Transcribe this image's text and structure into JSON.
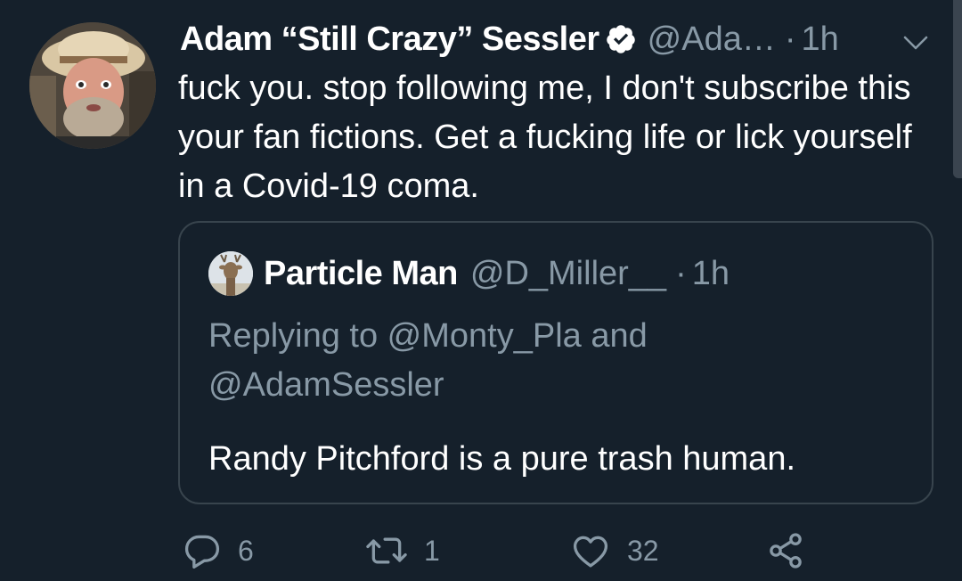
{
  "tweet": {
    "display_name": "Adam “Still Crazy” Sessler",
    "handle": "@Ada…",
    "separator": "·",
    "time": "1h",
    "text": "fuck you. stop following me, I don't subscribe this your fan fictions. Get a fucking life or lick yourself in a Covid-19 coma.",
    "icons": {
      "verified": "verified-badge-icon",
      "menu": "chevron-down-icon"
    }
  },
  "quote": {
    "display_name": "Particle Man",
    "handle": "@D_Miller__",
    "separator": "·",
    "time": "1h",
    "replying_to": "Replying to @Monty_Pla and @AdamSessler",
    "text": "Randy Pitchford is a pure trash human."
  },
  "actions": {
    "reply_count": "6",
    "retweet_count": "1",
    "like_count": "32",
    "icons": [
      "reply-icon",
      "retweet-icon",
      "like-icon",
      "share-icon"
    ]
  },
  "colors": {
    "background": "#15202b",
    "text_primary": "#ffffff",
    "text_secondary": "#8899a6",
    "border": "#38444d"
  }
}
